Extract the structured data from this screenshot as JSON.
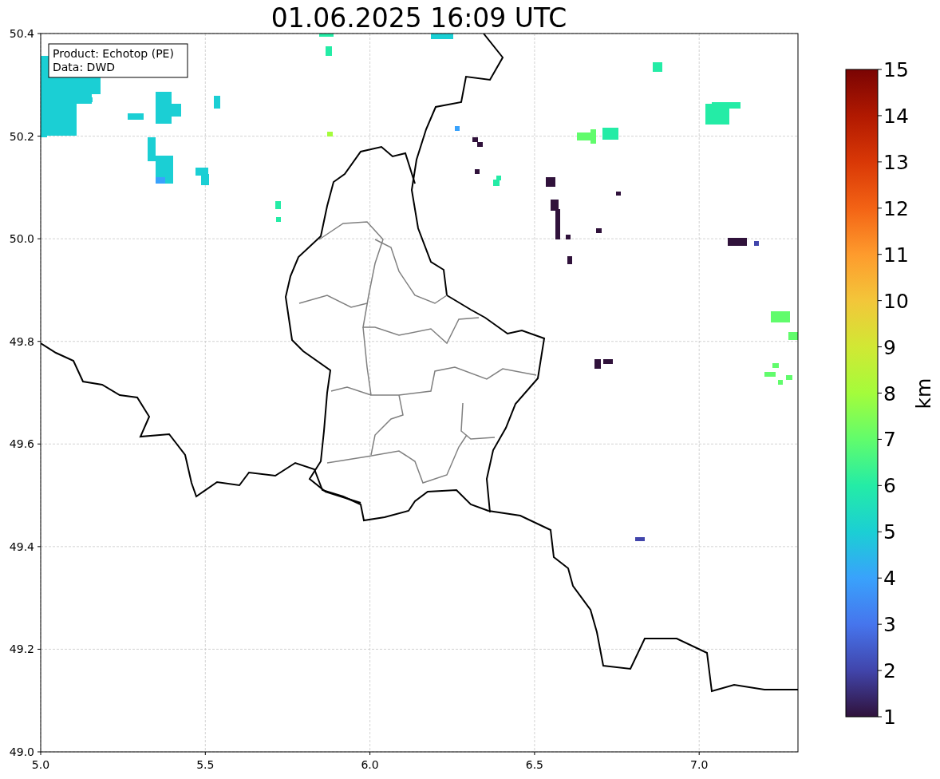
{
  "title": "01.06.2025 16:09 UTC",
  "map": {
    "info": [
      "Product: Echotop (PE)",
      "Data: DWD"
    ],
    "xticks": [
      "5.0",
      "5.5",
      "6.0",
      "6.5",
      "7.0"
    ],
    "yticks": [
      "50.4",
      "50.2",
      "50.0",
      "49.8",
      "49.6",
      "49.4",
      "49.2",
      "49.0"
    ]
  },
  "colorbar": {
    "label": "km",
    "ticks": [
      "15",
      "14",
      "13",
      "12",
      "11",
      "10",
      "9",
      "8",
      "7",
      "6",
      "5",
      "4",
      "3",
      "2",
      "1"
    ]
  }
}
